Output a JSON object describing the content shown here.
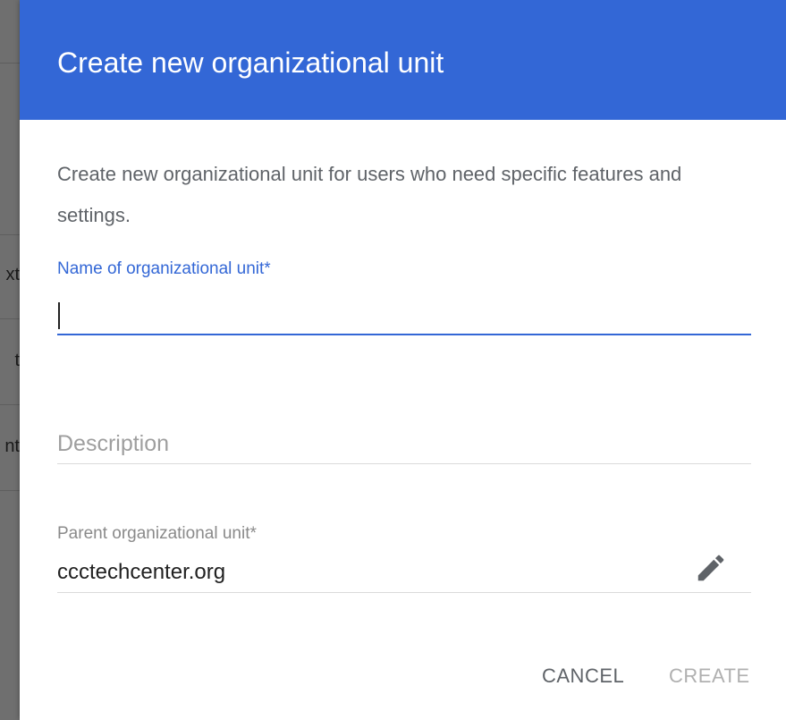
{
  "background": {
    "partial_texts": [
      "xt",
      "t",
      "nt"
    ]
  },
  "dialog": {
    "title": "Create new organizational unit",
    "description": "Create new organizational unit for users who need specific features and settings.",
    "name_field": {
      "label": "Name of organizational unit*",
      "value": ""
    },
    "description_field": {
      "placeholder": "Description",
      "value": ""
    },
    "parent_field": {
      "label": "Parent organizational unit*",
      "value": "ccctechcenter.org",
      "edit_icon": "pencil-icon"
    },
    "buttons": {
      "cancel_label": "CANCEL",
      "create_label": "CREATE"
    },
    "colors": {
      "header": "#3367d6",
      "accent": "#3367d6",
      "disabled_text": "#b0b0b0"
    }
  }
}
